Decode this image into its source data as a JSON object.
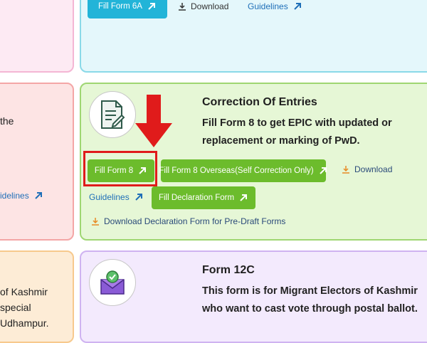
{
  "top_card": {
    "fill_form_button": "Fill Form 6A",
    "download_label": "Download",
    "guidelines_label": "Guidelines"
  },
  "left_column": {
    "red_text": "the",
    "red_link": "idelines",
    "orange_lines": [
      "of Kashmir",
      "special",
      "Udhampur."
    ]
  },
  "correction_card": {
    "title": "Correction Of Entries",
    "description": "Fill Form 8 to get EPIC with updated or replacement or marking of PwD.",
    "fill_form_button": "Fill Form 8",
    "overseas_button": "Fill Form 8 Overseas(Self Correction Only)",
    "download_label": "Download",
    "guidelines_label": "Guidelines",
    "declaration_button": "Fill Declaration Form",
    "predraft_link": "Download Declaration Form for Pre-Draft Forms",
    "icon": "document-edit-icon"
  },
  "form12c_card": {
    "title": "Form 12C",
    "description": "This form is for Migrant Electors of Kashmir who want to cast vote through postal ballot.",
    "icon": "envelope-check-icon"
  },
  "annotation": {
    "color": "#e01b1b"
  }
}
